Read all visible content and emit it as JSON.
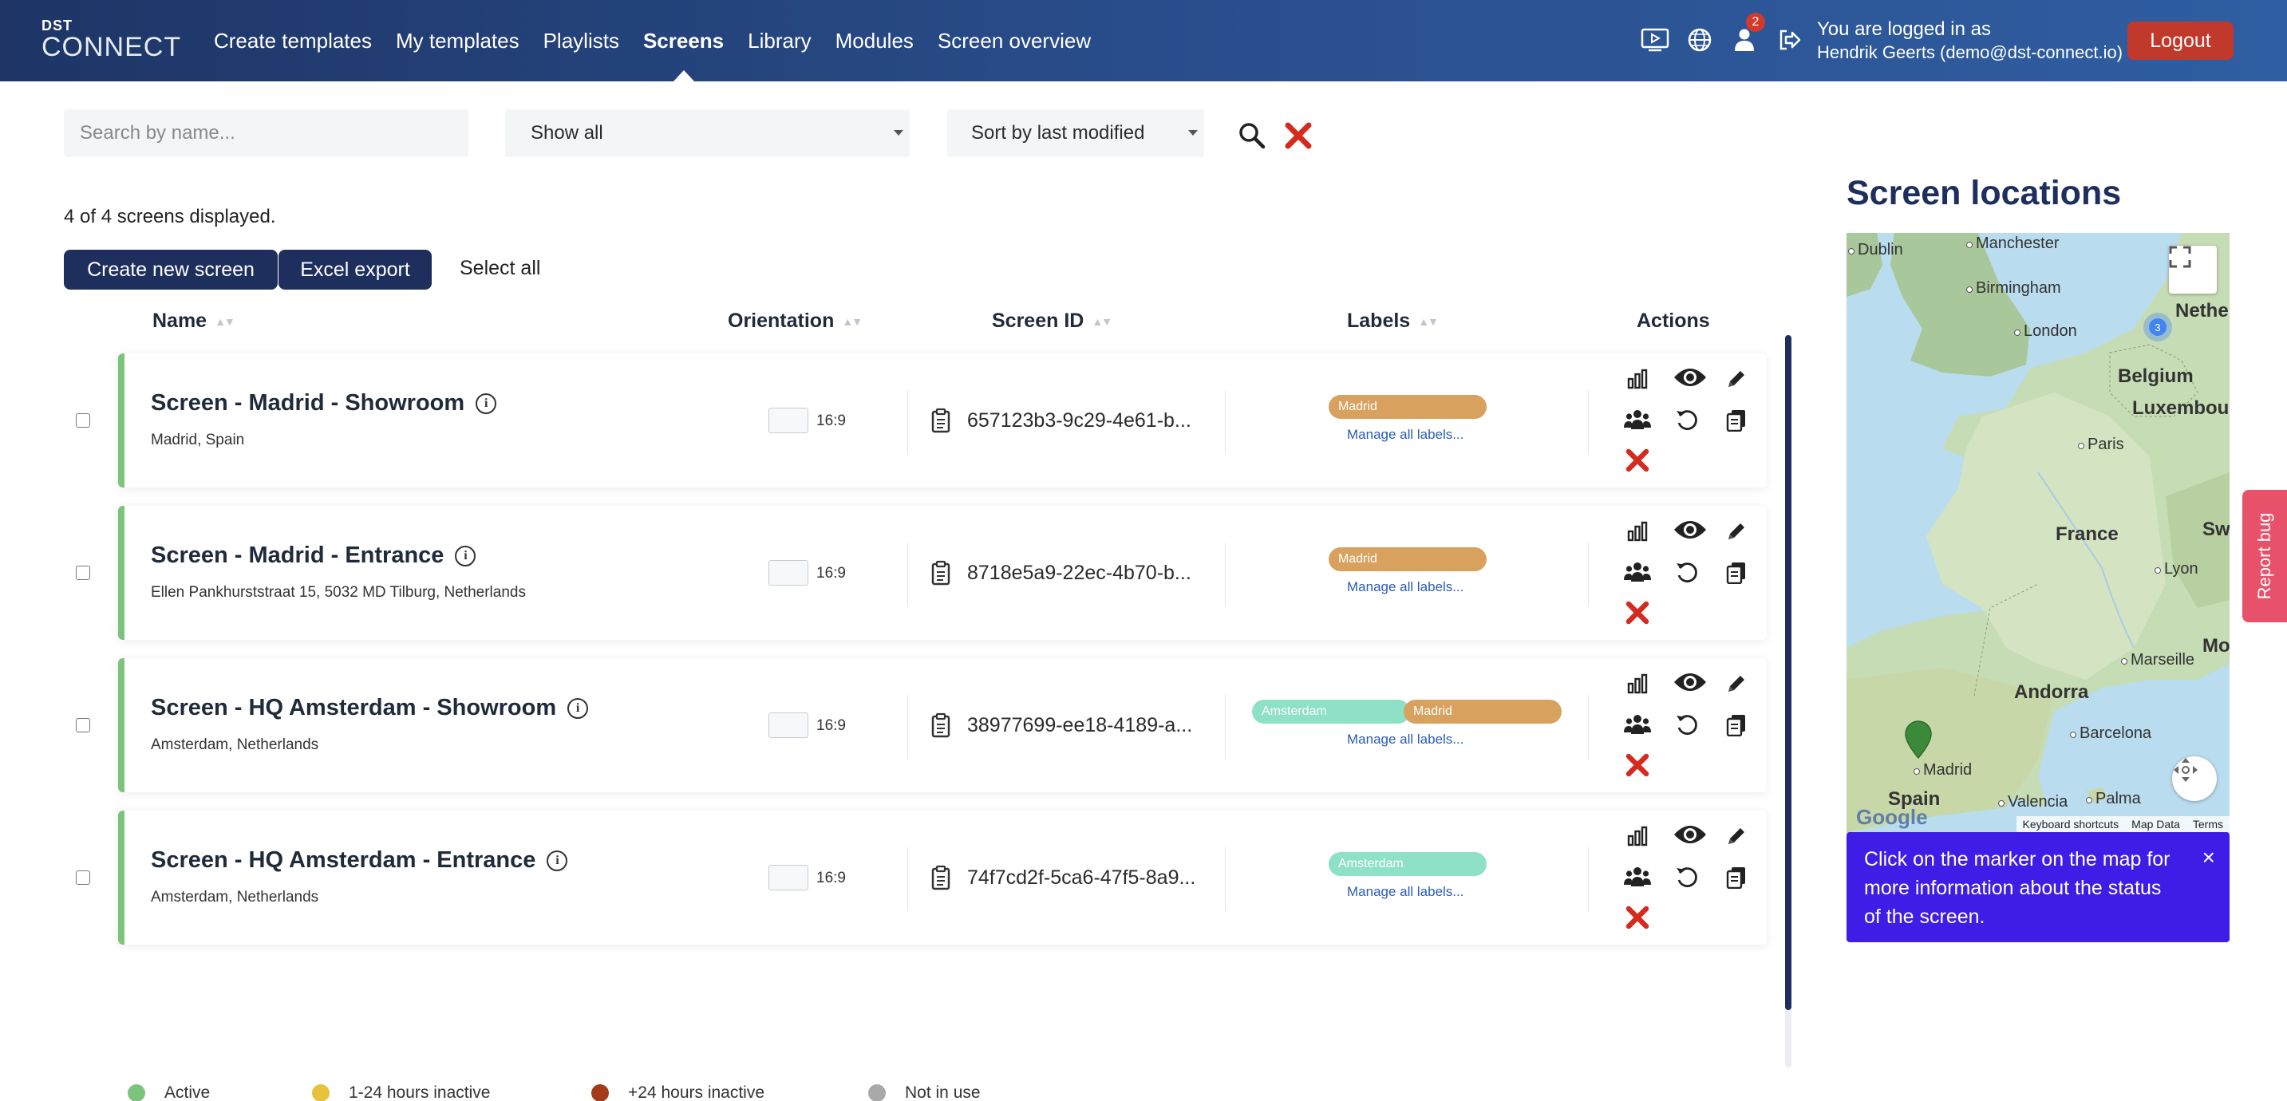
{
  "brand": {
    "top": "DST",
    "main": "CONNECT"
  },
  "nav": {
    "items": [
      {
        "label": "Create templates",
        "active": false
      },
      {
        "label": "My templates",
        "active": false
      },
      {
        "label": "Playlists",
        "active": false
      },
      {
        "label": "Screens",
        "active": true
      },
      {
        "label": "Library",
        "active": false
      },
      {
        "label": "Modules",
        "active": false
      },
      {
        "label": "Screen overview",
        "active": false
      }
    ]
  },
  "top_icons": {
    "preview": "screen-play-icon",
    "language": "globe-icon",
    "user": "user-icon",
    "logout": "sign-out-icon",
    "notification_count": "2"
  },
  "user": {
    "line1": "You are logged in as",
    "line2": "Hendrik Geerts (demo@dst-connect.io)"
  },
  "logout_label": "Logout",
  "filters": {
    "search_placeholder": "Search by name...",
    "show": "Show all",
    "sort": "Sort by last modified"
  },
  "count_text": "4 of 4 screens displayed.",
  "buttons": {
    "create": "Create new screen",
    "excel": "Excel export",
    "select_all": "Select all"
  },
  "columns": {
    "name": "Name",
    "orientation": "Orientation",
    "screen_id": "Screen ID",
    "labels": "Labels",
    "actions": "Actions"
  },
  "manage_labels_text": "Manage all labels...",
  "rows": [
    {
      "name": "Screen - Madrid - Showroom",
      "location": "Madrid, Spain",
      "orientation": "16:9",
      "screen_id": "657123b3-9c29-4e61-b...",
      "labels": [
        "Madrid"
      ],
      "status": "active"
    },
    {
      "name": "Screen - Madrid - Entrance",
      "location": "Ellen Pankhurststraat 15, 5032 MD Tilburg, Netherlands",
      "orientation": "16:9",
      "screen_id": "8718e5a9-22ec-4b70-b...",
      "labels": [
        "Madrid"
      ],
      "status": "active"
    },
    {
      "name": "Screen - HQ Amsterdam - Showroom",
      "location": "Amsterdam, Netherlands",
      "orientation": "16:9",
      "screen_id": "38977699-ee18-4189-a...",
      "labels": [
        "Amsterdam",
        "Madrid"
      ],
      "status": "active"
    },
    {
      "name": "Screen - HQ Amsterdam - Entrance",
      "location": "Amsterdam, Netherlands",
      "orientation": "16:9",
      "screen_id": "74f7cd2f-5ca6-47f5-8a9...",
      "labels": [
        "Amsterdam"
      ],
      "status": "active"
    }
  ],
  "label_colors": {
    "Madrid": "#d9a15e",
    "Amsterdam": "#8ee0c7"
  },
  "status_colors": {
    "active": "#7cc47c",
    "inactive_short": "#e6c33a",
    "inactive_long": "#a33b1b",
    "not_in_use": "#a9a9a9"
  },
  "legend": [
    "Active",
    "1-24 hours inactive",
    "+24 hours inactive",
    "Not in use"
  ],
  "map": {
    "title": "Screen locations",
    "cities": [
      "Dublin",
      "Manchester",
      "Birmingham",
      "London",
      "Paris",
      "Lyon",
      "Marseille",
      "Barcelona",
      "Madrid",
      "Valencia",
      "Palma"
    ],
    "countries": [
      "Netherlands",
      "Belgium",
      "Luxembourg",
      "France",
      "Switz",
      "Andorra",
      "Spain",
      "Mona"
    ],
    "cluster_count": "3",
    "footer": [
      "Keyboard shortcuts",
      "Map Data",
      "Terms"
    ],
    "google": "Google",
    "info": "Click on the marker on the map for more information about the status of the screen.",
    "info_close": "×"
  },
  "report_bug": "Report bug"
}
